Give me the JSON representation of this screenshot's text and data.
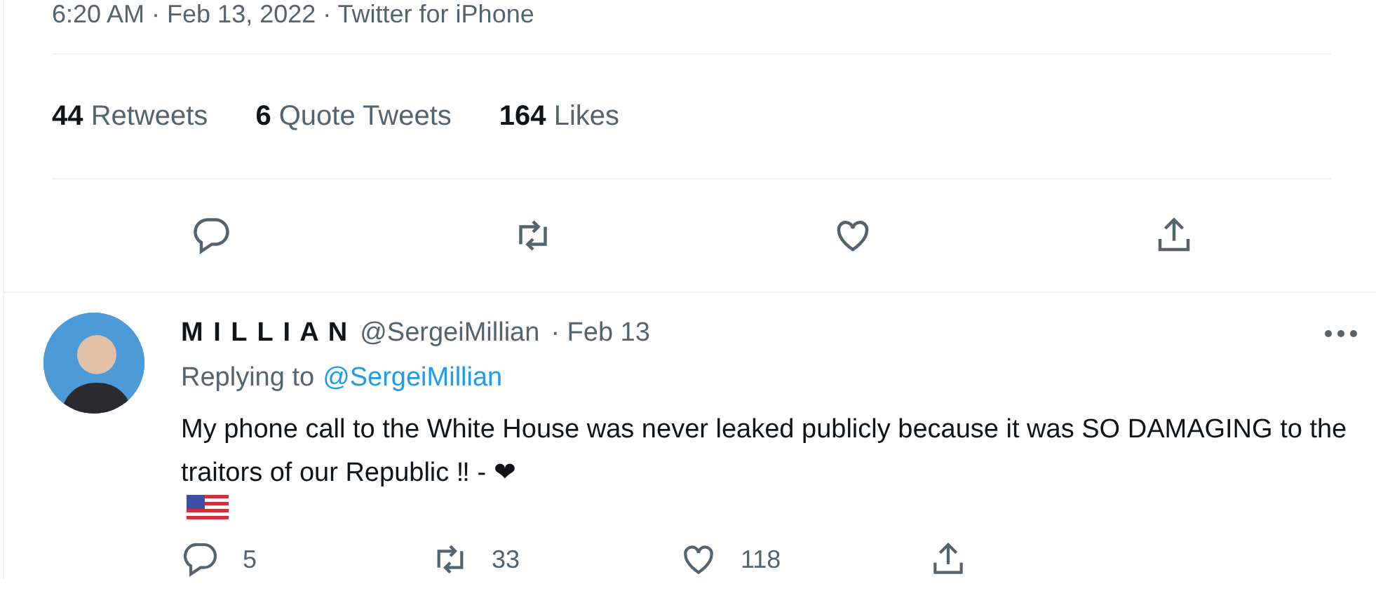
{
  "tweet": {
    "meta": "6:20 AM · Feb 13, 2022 · Twitter for iPhone",
    "stats": [
      {
        "count": "44",
        "label": "Retweets"
      },
      {
        "count": "6",
        "label": "Quote Tweets"
      },
      {
        "count": "164",
        "label": "Likes"
      }
    ],
    "actions": [
      {
        "kind": "reply"
      },
      {
        "kind": "retweet"
      },
      {
        "kind": "like"
      },
      {
        "kind": "share"
      }
    ]
  },
  "reply": {
    "name": "M I L L I A N",
    "handle": "@SergeiMillian",
    "date": "· Feb 13",
    "replying_label": "Replying to",
    "replying_to": "@SergeiMillian",
    "text": "My phone call to the White House was never leaked publicly because it was SO DAMAGING to the traitors of our Republic ‼ - ❤",
    "actions": [
      {
        "kind": "reply",
        "count": "5"
      },
      {
        "kind": "retweet",
        "count": "33"
      },
      {
        "kind": "like",
        "count": "118"
      },
      {
        "kind": "share"
      }
    ]
  }
}
